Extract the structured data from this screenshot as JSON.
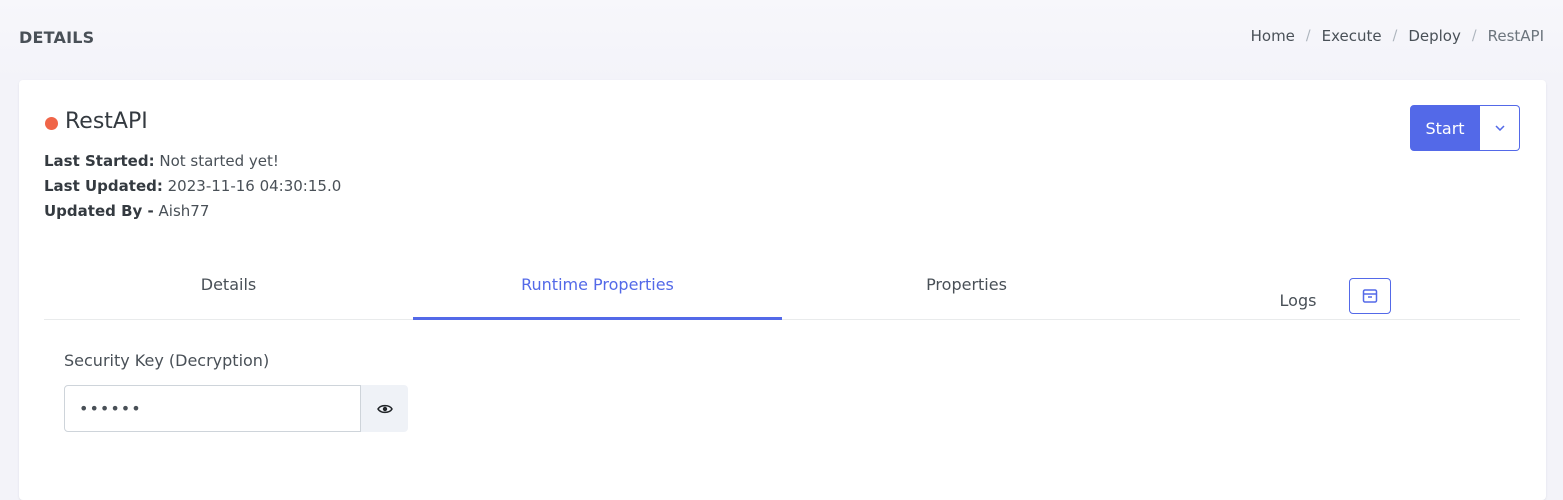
{
  "header": {
    "title": "DETAILS",
    "breadcrumb": [
      "Home",
      "Execute",
      "Deploy",
      "RestAPI"
    ],
    "separator": "/"
  },
  "app": {
    "name": "RestAPI",
    "status_color": "#f06548",
    "last_started_label": "Last Started:",
    "last_started_value": "Not started yet!",
    "last_updated_label": "Last Updated:",
    "last_updated_value": "2023-11-16 04:30:15.0",
    "updated_by_label": "Updated By -",
    "updated_by_value": "Aish77"
  },
  "actions": {
    "start_label": "Start",
    "caret_icon": "chevron-down-icon",
    "accent": "#5369e8"
  },
  "tabs": [
    {
      "label": "Details",
      "active": false
    },
    {
      "label": "Runtime Properties",
      "active": true
    },
    {
      "label": "Properties",
      "active": false
    },
    {
      "label": "Logs",
      "active": false,
      "icon": "archive-icon"
    }
  ],
  "runtime": {
    "security_key_label": "Security Key (Decryption)",
    "security_key_value": "••••••",
    "visibility_icon": "eye-icon"
  }
}
